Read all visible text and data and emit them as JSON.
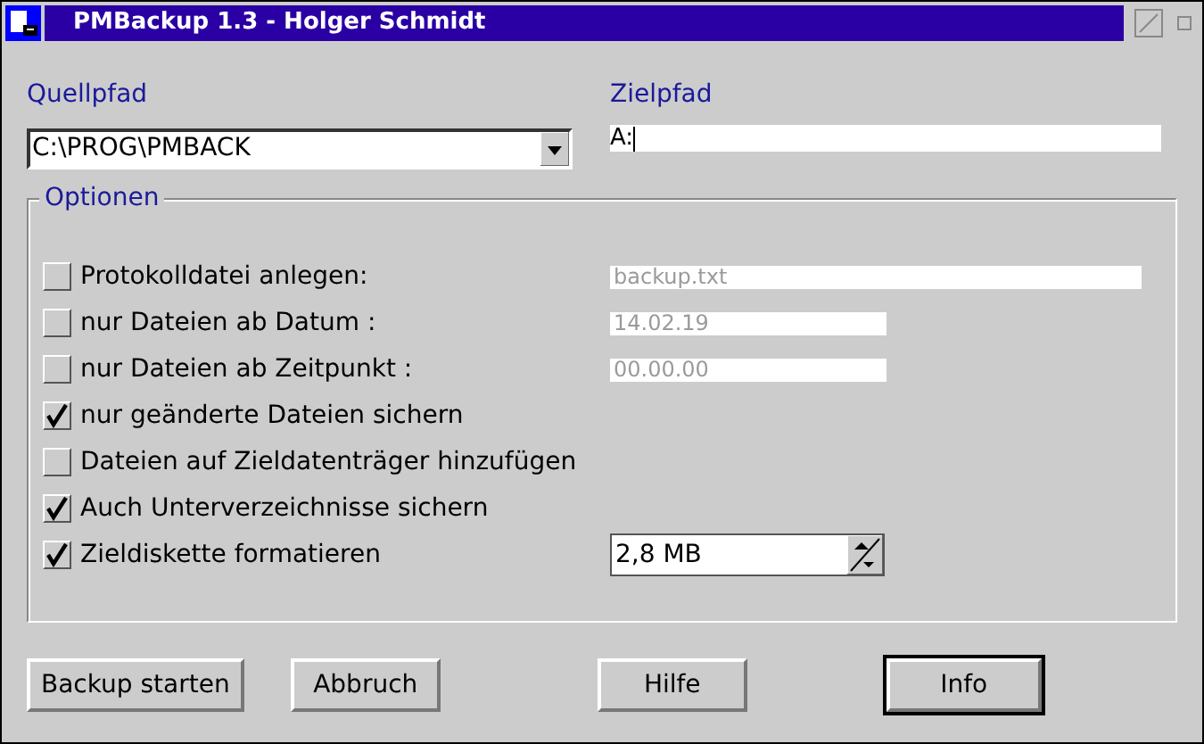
{
  "window": {
    "title": "PMBackup 1.3 - Holger Schmidt"
  },
  "source": {
    "label": "Quellpfad",
    "value": "C:\\PROG\\PMBACK"
  },
  "target": {
    "label": "Zielpfad",
    "value": "A:"
  },
  "options": {
    "title": "Optionen",
    "items": [
      {
        "label": "Protokolldatei anlegen:",
        "checked": false,
        "field": {
          "kind": "file",
          "value": "backup.txt",
          "disabled": true
        }
      },
      {
        "label": "nur Dateien ab Datum :",
        "checked": false,
        "field": {
          "kind": "date",
          "value": "14.02.19",
          "disabled": true
        }
      },
      {
        "label": "nur Dateien ab Zeitpunkt :",
        "checked": false,
        "field": {
          "kind": "time",
          "value": "00.00.00",
          "disabled": true
        }
      },
      {
        "label": "nur geänderte Dateien sichern",
        "checked": true
      },
      {
        "label": "Dateien auf Zieldatenträger hinzufügen",
        "checked": false
      },
      {
        "label": "Auch Unterverzeichnisse sichern",
        "checked": true
      },
      {
        "label": "Zieldiskette formatieren",
        "checked": true,
        "field": {
          "kind": "spin",
          "value": "2,8 MB",
          "disabled": false
        }
      }
    ]
  },
  "buttons": [
    {
      "label": "Backup starten",
      "default": false
    },
    {
      "label": "Abbruch",
      "default": false
    },
    {
      "label": "Hilfe",
      "default": false
    },
    {
      "label": "Info",
      "default": true
    }
  ]
}
